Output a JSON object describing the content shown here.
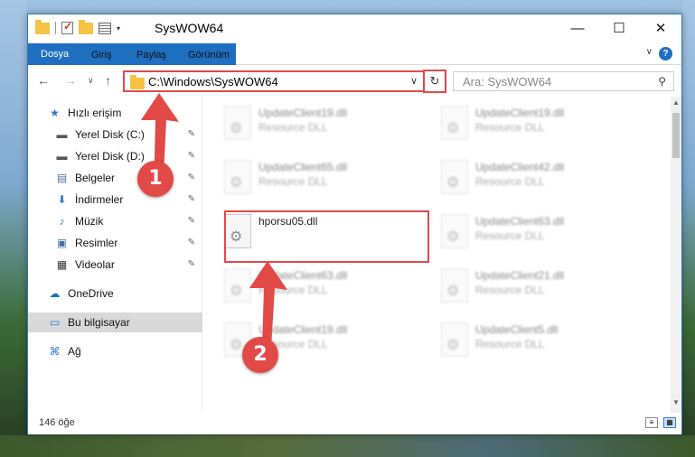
{
  "window": {
    "title": "SysWOW64",
    "minimize_glyph": "—",
    "maximize_glyph": "☐",
    "close_glyph": "✕"
  },
  "ribbon": {
    "tabs": [
      {
        "label": "Dosya"
      },
      {
        "label": "Giriş"
      },
      {
        "label": "Paylaş"
      },
      {
        "label": "Görünüm"
      }
    ],
    "help_glyph": "?",
    "collapse_glyph": "∨"
  },
  "nav": {
    "back_glyph": "←",
    "forward_glyph": "→",
    "recent_glyph": "∨",
    "up_glyph": "↑",
    "address": "C:\\Windows\\SysWOW64",
    "address_chevron": "∨",
    "refresh_glyph": "↻",
    "search_placeholder": "Ara: SysWOW64",
    "search_glyph": "⚲"
  },
  "sidebar": {
    "items": [
      {
        "label": "Hızlı erişim",
        "icon": "star-icon",
        "glyph": "★",
        "pinned": false
      },
      {
        "label": "Yerel Disk (C:)",
        "icon": "drive-icon",
        "glyph": "▬",
        "pinned": true
      },
      {
        "label": "Yerel Disk (D:)",
        "icon": "drive-icon",
        "glyph": "▬",
        "pinned": true
      },
      {
        "label": "Belgeler",
        "icon": "documents-icon",
        "glyph": "▤",
        "pinned": true
      },
      {
        "label": "İndirmeler",
        "icon": "download-icon",
        "glyph": "⬇",
        "pinned": true
      },
      {
        "label": "Müzik",
        "icon": "music-icon",
        "glyph": "♪",
        "pinned": true
      },
      {
        "label": "Resimler",
        "icon": "pictures-icon",
        "glyph": "▣",
        "pinned": true
      },
      {
        "label": "Videolar",
        "icon": "video-icon",
        "glyph": "▦",
        "pinned": true
      },
      {
        "label": "OneDrive",
        "icon": "cloud-icon",
        "glyph": "☁",
        "pinned": false
      },
      {
        "label": "Bu bilgisayar",
        "icon": "computer-icon",
        "glyph": "▭",
        "pinned": false
      },
      {
        "label": "Ağ",
        "icon": "network-icon",
        "glyph": "⌘",
        "pinned": false
      }
    ],
    "pin_glyph": "✎"
  },
  "files": [
    {
      "name": "UpdateClient19.dll",
      "desc": "Resource DLL",
      "blurred": true
    },
    {
      "name": "UpdateClient19.dll",
      "desc": "Resource DLL",
      "blurred": true
    },
    {
      "name": "UpdateClient65.dll",
      "desc": "Resource DLL",
      "blurred": true
    },
    {
      "name": "UpdateClient42.dll",
      "desc": "Resource DLL",
      "blurred": true
    },
    {
      "name": "hporsu05.dll",
      "desc": "",
      "blurred": false
    },
    {
      "name": "UpdateClient63.dll",
      "desc": "Resource DLL",
      "blurred": true
    },
    {
      "name": "UpdateClient63.dll",
      "desc": "Resource DLL",
      "blurred": true
    },
    {
      "name": "UpdateClient21.dll",
      "desc": "Resource DLL",
      "blurred": true
    },
    {
      "name": "UpdateClient19.dll",
      "desc": "Resource DLL",
      "blurred": true
    },
    {
      "name": "UpdateClient5.dll",
      "desc": "Resource DLL",
      "blurred": true
    }
  ],
  "status": {
    "item_count": "146 öğe"
  },
  "annotations": {
    "step1": "1",
    "step2": "2",
    "color": "#e24a47"
  }
}
